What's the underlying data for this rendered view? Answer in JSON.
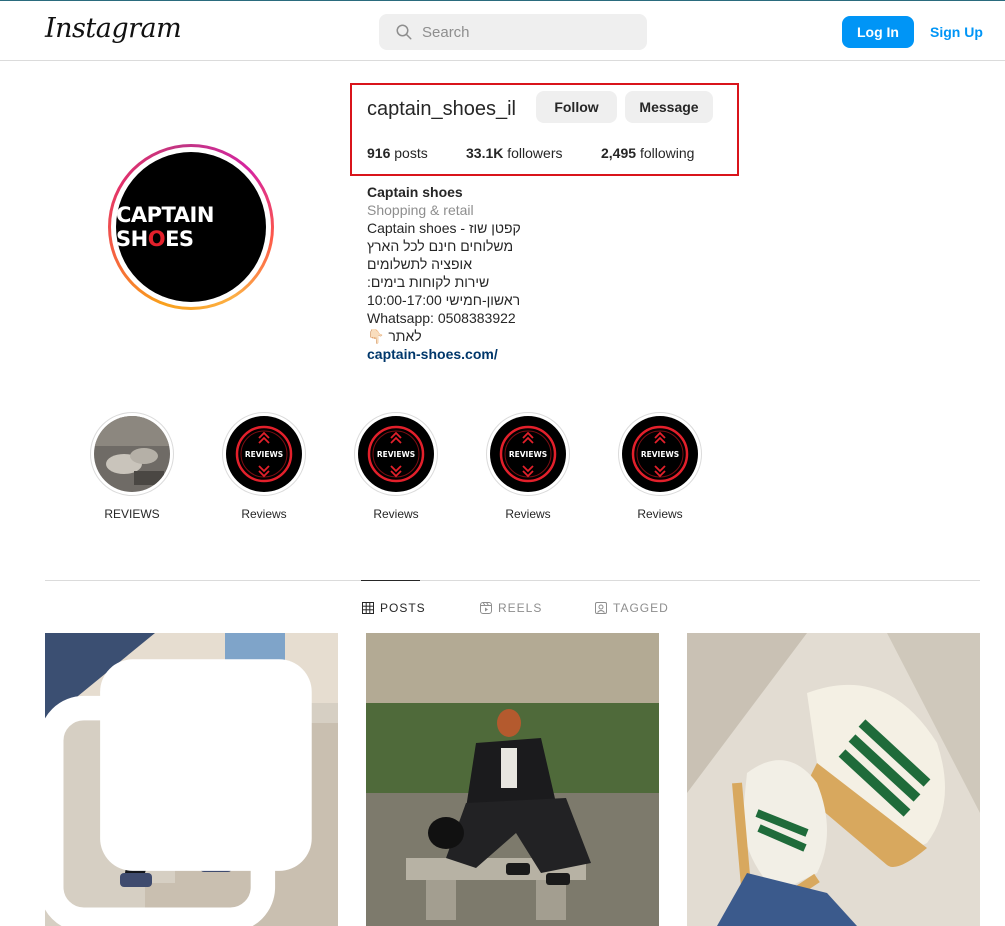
{
  "header": {
    "logo_text": "Instagram",
    "search_placeholder": "Search",
    "login_label": "Log In",
    "signup_label": "Sign Up"
  },
  "profile": {
    "username": "captain_shoes_il",
    "follow_label": "Follow",
    "message_label": "Message",
    "stats": {
      "posts_count": "916",
      "posts_label": "posts",
      "followers_count": "33.1K",
      "followers_label": "followers",
      "following_count": "2,495",
      "following_label": "following"
    },
    "avatar_text": {
      "part1": "CAPTAIN SH",
      "part2": "O",
      "part3": "ES"
    },
    "bio": {
      "name": "Captain shoes",
      "category": "Shopping & retail",
      "lines": [
        "Captain shoes - קפטן שוז",
        "משלוחים חינם לכל הארץ",
        "אופציה לתשלומים",
        "שירות לקוחות בימים:",
        "ראשון-חמישי 10:00-17:00",
        "Whatsapp: 0508383922",
        "לאתר 👇🏻"
      ],
      "link": "captain-shoes.com/"
    }
  },
  "highlights": [
    {
      "label": "REVIEWS",
      "icon": "photo-thumbnail"
    },
    {
      "label": "Reviews",
      "icon": "reviews-badge-icon",
      "badge_text": "REVIEWS"
    },
    {
      "label": "Reviews",
      "icon": "reviews-badge-icon",
      "badge_text": "REVIEWS"
    },
    {
      "label": "Reviews",
      "icon": "reviews-badge-icon",
      "badge_text": "REVIEWS"
    },
    {
      "label": "Reviews",
      "icon": "reviews-badge-icon",
      "badge_text": "REVIEWS"
    }
  ],
  "tabs": [
    {
      "label": "POSTS",
      "icon": "grid-icon",
      "active": true
    },
    {
      "label": "REELS",
      "icon": "reels-icon",
      "active": false
    },
    {
      "label": "TAGGED",
      "icon": "tagged-icon",
      "active": false
    }
  ],
  "colors": {
    "primary_blue": "#0095f6",
    "annotation_red": "#d9141b",
    "link_navy": "#00376b"
  }
}
